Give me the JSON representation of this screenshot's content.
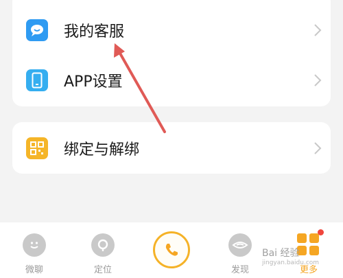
{
  "menu": {
    "customer_service": "我的客服",
    "app_settings": "APP设置",
    "bind_unbind": "绑定与解绑"
  },
  "tabs": [
    {
      "label": "微聊",
      "icon": "smiley-chat-icon"
    },
    {
      "label": "定位",
      "icon": "location-pin-icon"
    },
    {
      "label": "",
      "icon": "phone-icon"
    },
    {
      "label": "发现",
      "icon": "discover-eye-icon"
    },
    {
      "label": "更多",
      "icon": "more-grid-icon"
    }
  ],
  "watermark": {
    "line1": "Bai 经验",
    "line2": "jingyan.baidu.com"
  },
  "colors": {
    "accent": "#f5a623",
    "call_ring": "#f5b227",
    "arrow": "#e05a56",
    "service_icon": "#2f9bf2",
    "settings_icon": "#35aef0",
    "bind_icon": "#f5b528"
  }
}
